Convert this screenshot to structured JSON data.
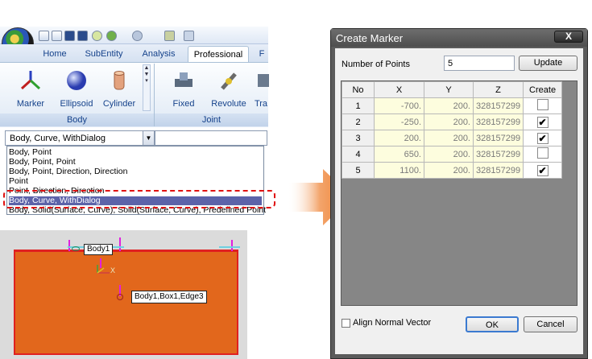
{
  "ribbon": {
    "tabs": [
      "Home",
      "SubEntity",
      "Analysis",
      "Professional",
      "F"
    ],
    "active_tab": "Professional",
    "body_group": {
      "label": "Body",
      "buttons": [
        "Marker",
        "Ellipsoid",
        "Cylinder"
      ]
    },
    "joint_group": {
      "label": "Joint",
      "buttons": [
        "Fixed",
        "Revolute",
        "Tra"
      ]
    }
  },
  "combo": {
    "value": "Body, Curve, WithDialog",
    "options": [
      "Body, Point",
      "Body, Point, Point",
      "Body, Point, Direction, Direction",
      "Point",
      "Point, Direction, Direction",
      "Body, Curve, WithDialog",
      "Body, Solid(Surface, Curve), Solid(Surface, Curve), Predefined Point"
    ],
    "selected_index": 5
  },
  "viewport": {
    "tags": [
      "Body1",
      "Body1,Box1,Edge3"
    ],
    "axis_x": "X"
  },
  "dialog": {
    "title": "Create Marker",
    "close_label": "X",
    "num_points_label": "Number of Points",
    "num_points_value": "5",
    "update_label": "Update",
    "columns": [
      "No",
      "X",
      "Y",
      "Z",
      "Create"
    ],
    "rows": [
      {
        "no": "1",
        "x": "-700.",
        "y": "200.",
        "z": "328157299",
        "checked": false
      },
      {
        "no": "2",
        "x": "-250.",
        "y": "200.",
        "z": "328157299",
        "checked": true
      },
      {
        "no": "3",
        "x": "200.",
        "y": "200.",
        "z": "328157299",
        "checked": true
      },
      {
        "no": "4",
        "x": "650.",
        "y": "200.",
        "z": "328157299",
        "checked": false
      },
      {
        "no": "5",
        "x": "1100.",
        "y": "200.",
        "z": "328157299",
        "checked": true
      }
    ],
    "align_label": "Align Normal Vector",
    "ok_label": "OK",
    "cancel_label": "Cancel"
  },
  "colors": {
    "accent_red": "#e01010",
    "box_orange": "#e2671c",
    "list_selection": "#5c63a9",
    "arrow_orange": "#f08a3c"
  }
}
